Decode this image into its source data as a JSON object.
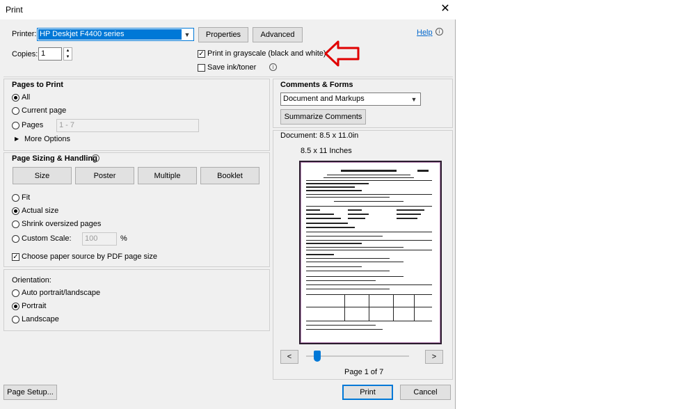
{
  "window": {
    "title": "Print"
  },
  "printer": {
    "label": "Printer:",
    "selected": "HP Deskjet F4400 series",
    "properties": "Properties",
    "advanced": "Advanced",
    "help": "Help"
  },
  "copies": {
    "label": "Copies:",
    "value": "1"
  },
  "options": {
    "grayscale": {
      "label": "Print in grayscale (black and white)",
      "checked": true
    },
    "save_ink": {
      "label": "Save ink/toner",
      "checked": false
    }
  },
  "pages_to_print": {
    "heading": "Pages to Print",
    "all": "All",
    "current": "Current page",
    "pages": "Pages",
    "pages_placeholder": "1 - 7",
    "more": "More Options"
  },
  "sizing": {
    "heading": "Page Sizing & Handling",
    "tabs": [
      "Size",
      "Poster",
      "Multiple",
      "Booklet"
    ],
    "fit": "Fit",
    "actual": "Actual size",
    "shrink": "Shrink oversized pages",
    "custom": "Custom Scale:",
    "custom_value": "100",
    "percent": "%",
    "paper_source": "Choose paper source by PDF page size"
  },
  "orientation": {
    "heading": "Orientation:",
    "auto": "Auto portrait/landscape",
    "portrait": "Portrait",
    "landscape": "Landscape"
  },
  "comments": {
    "heading": "Comments & Forms",
    "selected": "Document and Markups",
    "summarize": "Summarize Comments"
  },
  "preview": {
    "document": "Document: 8.5 x 11.0in",
    "paper": "8.5 x 11 Inches",
    "page_status": "Page 1 of 7",
    "prev": "<",
    "next": ">",
    "slider_position": 0.0
  },
  "footer": {
    "page_setup": "Page Setup...",
    "print": "Print",
    "cancel": "Cancel"
  },
  "annotation": {
    "arrow_color": "#e00000"
  }
}
